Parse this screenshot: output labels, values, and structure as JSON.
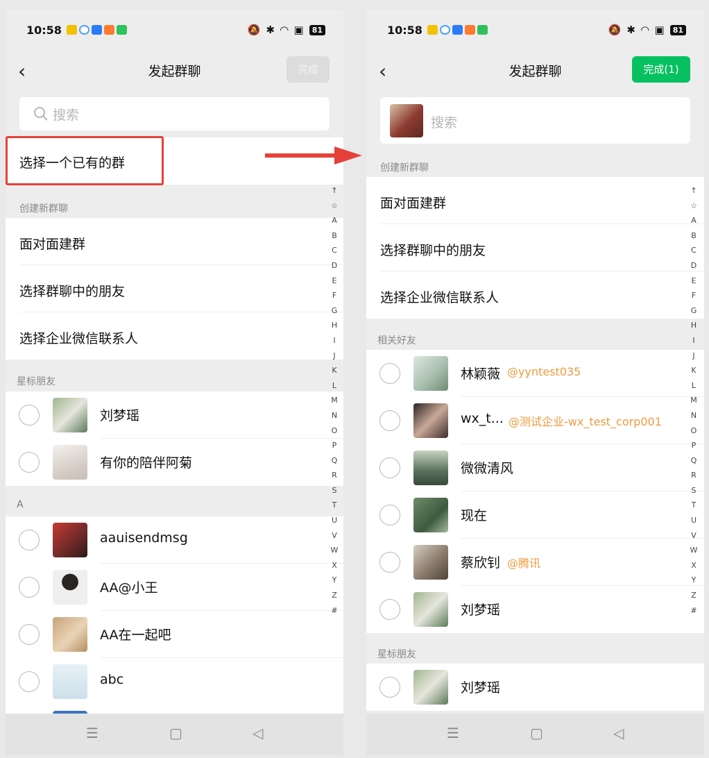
{
  "status_bar": {
    "time": "10:58",
    "battery": "81"
  },
  "left": {
    "title": "发起群聊",
    "done_label": "完成",
    "search_placeholder": "搜索",
    "existing_group": "选择一个已有的群",
    "section_create": "创建新群聊",
    "actions": [
      "面对面建群",
      "选择群聊中的朋友",
      "选择企业微信联系人"
    ],
    "section_starred": "星标朋友",
    "starred": [
      {
        "name": "刘梦瑶"
      },
      {
        "name": "有你的陪伴阿菊"
      }
    ],
    "section_a": "A",
    "contacts_a": [
      {
        "name": "aauisendmsg"
      },
      {
        "name": "AA@小王"
      },
      {
        "name": "AA在一起吧"
      },
      {
        "name": "abc"
      }
    ]
  },
  "right": {
    "title": "发起群聊",
    "done_label": "完成(1)",
    "search_placeholder": "搜索",
    "section_create": "创建新群聊",
    "actions": [
      "面对面建群",
      "选择群聊中的朋友",
      "选择企业微信联系人"
    ],
    "section_related": "相关好友",
    "related": [
      {
        "name": "林颖薇",
        "tag": "@yyntest035"
      },
      {
        "name": "wx_t...",
        "tag": "@测试企业-wx_test_corp001"
      },
      {
        "name": "微微清风",
        "tag": ""
      },
      {
        "name": "现在",
        "tag": ""
      },
      {
        "name": "蔡欣钊",
        "tag": "@腾讯"
      },
      {
        "name": "刘梦瑶",
        "tag": ""
      }
    ],
    "section_starred": "星标朋友",
    "starred": [
      {
        "name": "刘梦瑶"
      }
    ]
  },
  "index_letters": [
    "↑",
    "☆",
    "A",
    "B",
    "C",
    "D",
    "E",
    "F",
    "G",
    "H",
    "I",
    "J",
    "K",
    "L",
    "M",
    "N",
    "O",
    "P",
    "Q",
    "R",
    "S",
    "T",
    "U",
    "V",
    "W",
    "X",
    "Y",
    "Z",
    "#"
  ],
  "nav": {
    "menu_icon": "menu-icon",
    "home_icon": "home-icon",
    "back_icon": "back-triangle-icon"
  },
  "colors": {
    "accent_green": "#07c160",
    "highlight_red": "#e5413a",
    "tag_orange": "#f09a3e"
  }
}
